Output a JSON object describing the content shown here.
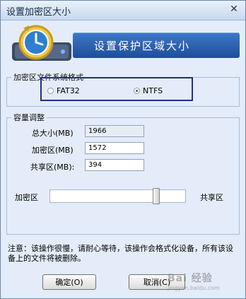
{
  "window": {
    "title": "设置加密区大小"
  },
  "banner": {
    "text": "设置保护区域大小",
    "accent": "#2a60b3"
  },
  "filesystem": {
    "legend": "加密区文件系统格式",
    "options": [
      {
        "label": "FAT32",
        "checked": false
      },
      {
        "label": "NTFS",
        "checked": true
      }
    ]
  },
  "capacity": {
    "legend": "容量调整",
    "total": {
      "label": "总大小(MB)",
      "value": "1966"
    },
    "encrypted": {
      "label": "加密区(MB)",
      "value": "1572"
    },
    "shared": {
      "label": "共享区(MB):",
      "value": "394"
    }
  },
  "slider": {
    "left_label": "加密区",
    "right_label": "共享区",
    "encrypted_fraction": 0.8
  },
  "note": "注意：该操作很慢，请耐心等待，该操作会格式化设备，所有该设备上的文件将被删除。",
  "buttons": {
    "ok": "确定(O)",
    "cancel": "取消(C)"
  },
  "watermark": {
    "text": "Bai 经验",
    "sub": "jingyan.baidu.com"
  }
}
